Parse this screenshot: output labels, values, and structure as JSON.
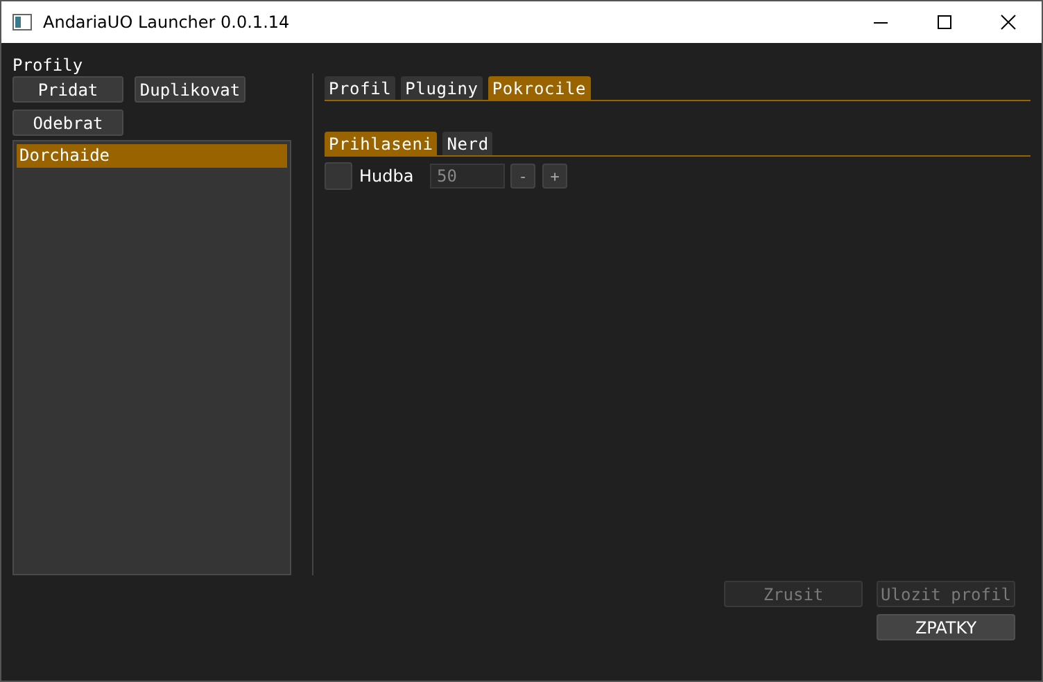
{
  "window": {
    "title": "AndariaUO Launcher 0.0.1.14"
  },
  "profiles": {
    "title": "Profily",
    "buttons": [
      {
        "label": "Pridat"
      },
      {
        "label": "Duplikovat"
      },
      {
        "label": "Odebrat"
      }
    ],
    "items": [
      {
        "label": "Dorchaide",
        "selected": true
      }
    ]
  },
  "tabs": [
    {
      "label": "Profil",
      "selected": false
    },
    {
      "label": "Pluginy",
      "selected": false
    },
    {
      "label": "Pokrocile",
      "selected": true
    }
  ],
  "subtabs": [
    {
      "label": "Prihlaseni",
      "selected": true
    },
    {
      "label": "Nerd",
      "selected": false
    }
  ],
  "settings": [
    {
      "label": "Hudba",
      "checked": false,
      "value": "50",
      "minus": "-",
      "plus": "+"
    }
  ],
  "footer": [
    {
      "label": "Zrusit",
      "disabled": true
    },
    {
      "label": "Ulozit profil",
      "disabled": true
    },
    {
      "label": "ZPATKY",
      "disabled": false
    }
  ]
}
